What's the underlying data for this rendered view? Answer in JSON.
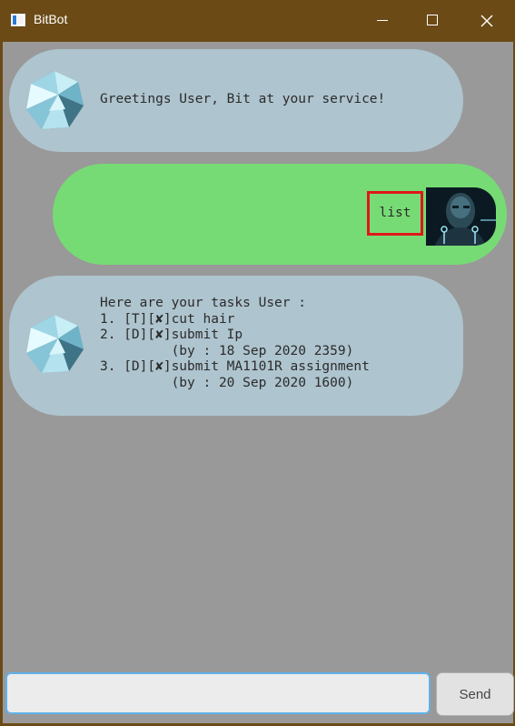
{
  "window": {
    "title": "BitBot",
    "icons": [
      "app-icon",
      "minimize-icon",
      "maximize-icon",
      "close-icon"
    ],
    "colors": {
      "titlebar": "#6b4a16",
      "chat_background": "#999999",
      "bot_bubble": "#aec4ce",
      "user_bubble": "#77db75",
      "highlight_box": "#e0161b",
      "input_focus_border": "#61b1ea"
    }
  },
  "chat": {
    "messages": [
      {
        "sender": "bot",
        "avatar_icon": "crystal-avatar-icon",
        "text": "Greetings User, Bit at your service!"
      },
      {
        "sender": "user",
        "avatar_icon": "user-photo-avatar",
        "text": "list"
      },
      {
        "sender": "bot",
        "avatar_icon": "crystal-avatar-icon",
        "text": "Here are your tasks User :\n1. [T][✘]cut hair\n2. [D][✘]submit Ip\n         (by : 18 Sep 2020 2359)\n3. [D][✘]submit MA1101R assignment\n         (by : 20 Sep 2020 1600)"
      }
    ]
  },
  "input": {
    "value": "",
    "placeholder": ""
  },
  "send_button": {
    "label": "Send"
  }
}
